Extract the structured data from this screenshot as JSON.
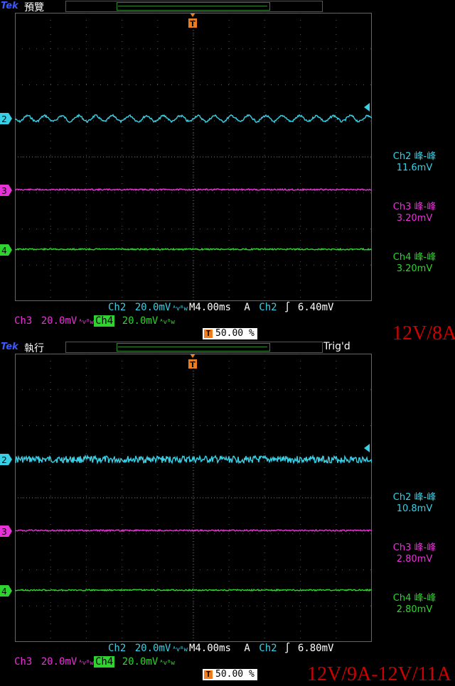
{
  "colors": {
    "ch2": "#39d0e6",
    "ch3": "#e832d8",
    "ch4": "#2fd32f",
    "trigger": "#f07c1c",
    "caption": "#d00000"
  },
  "panels": [
    {
      "brand": "Tek",
      "mode": "預覽",
      "trig_state": "",
      "measurements": [
        {
          "name": "Ch2 峰-峰",
          "value": "11.6mV"
        },
        {
          "name": "Ch3 峰-峰",
          "value": "3.20mV"
        },
        {
          "name": "Ch4 峰-峰",
          "value": "3.20mV"
        }
      ],
      "status": {
        "ch2": "Ch2",
        "ch2_scale": "20.0mV",
        "timebase": "M4.00ms",
        "acq": "A",
        "trig_src": "Ch2",
        "trig_level": "6.40mV",
        "ch3": "Ch3",
        "ch3_scale": "20.0mV",
        "ch4": "Ch4",
        "ch4_scale": "20.0mV",
        "trig_pos": "50.00 %",
        "bw": "ᴬᴠᴮᴡ"
      },
      "caption": "12V/8A"
    },
    {
      "brand": "Tek",
      "mode": "執行",
      "trig_state": "Trig'd",
      "measurements": [
        {
          "name": "Ch2 峰-峰",
          "value": "10.8mV"
        },
        {
          "name": "Ch3 峰-峰",
          "value": "2.80mV"
        },
        {
          "name": "Ch4 峰-峰",
          "value": "2.80mV"
        }
      ],
      "status": {
        "ch2": "Ch2",
        "ch2_scale": "20.0mV",
        "timebase": "M4.00ms",
        "acq": "A",
        "trig_src": "Ch2",
        "trig_level": "6.80mV",
        "ch3": "Ch3",
        "ch3_scale": "20.0mV",
        "ch4": "Ch4",
        "ch4_scale": "20.0mV",
        "trig_pos": "50.00 %",
        "bw": "ᴬᴠᴮᴡ"
      },
      "caption": "12V/9A-12V/11A"
    }
  ],
  "channel_markers": [
    "2",
    "3",
    "4"
  ],
  "trigger_marker": "T"
}
